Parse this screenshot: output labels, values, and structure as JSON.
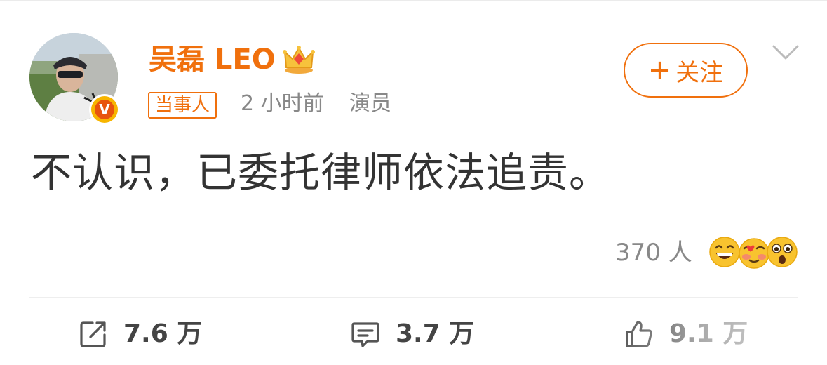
{
  "post": {
    "author": {
      "name": "吴磊 LEO",
      "verified_badge": "V",
      "crown_icon": "crown-icon",
      "avatar_icon": "avatar-photo"
    },
    "tag_label": "当事人",
    "time": "2 小时前",
    "role": "演员",
    "follow_label": "关注",
    "follow_plus": "+",
    "text": "不认识，已委托律师依法追责。",
    "reactions": {
      "count_label": "370 人",
      "emojis": [
        "grinning-emoji",
        "love-face-emoji",
        "surprised-emoji"
      ]
    }
  },
  "actions": {
    "repost": {
      "icon": "share-icon",
      "label": "7.6 万"
    },
    "comment": {
      "icon": "comment-icon",
      "label": "3.7 万"
    },
    "like": {
      "icon": "thumbs-up-icon",
      "label": "9.1 万"
    }
  },
  "colors": {
    "accent": "#f0700d",
    "text": "#333333",
    "muted": "#888888",
    "badge_gold": "#f7b500"
  }
}
